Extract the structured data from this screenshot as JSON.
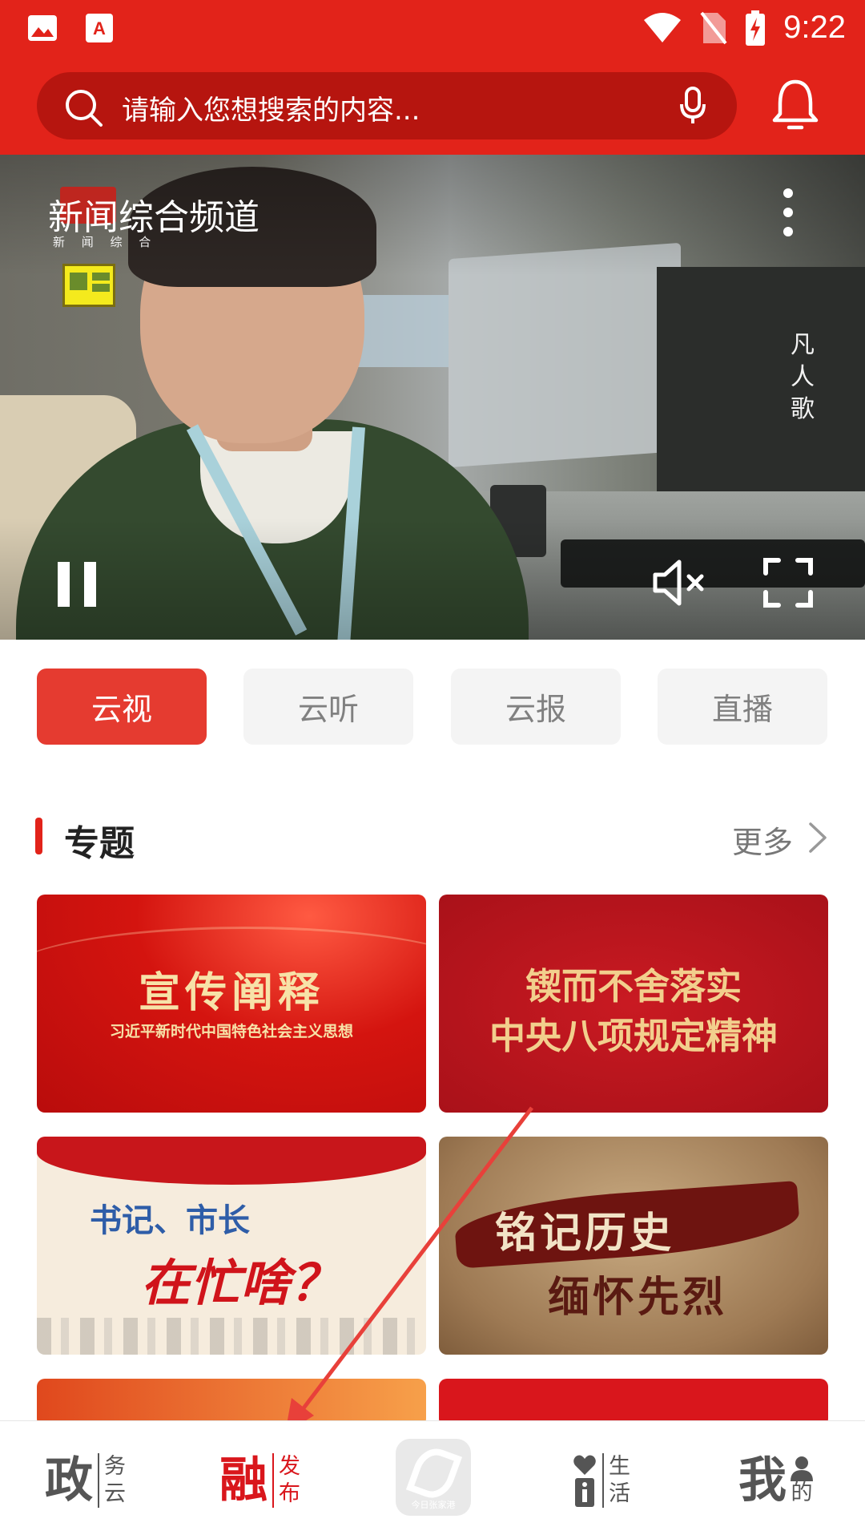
{
  "status_bar": {
    "time": "9:22",
    "icons": [
      "image-icon",
      "app-notification-icon",
      "wifi-icon",
      "no-sim-icon",
      "battery-charging-icon"
    ]
  },
  "header": {
    "search_placeholder": "请输入您想搜索的内容...",
    "icons": [
      "search-icon",
      "microphone-icon",
      "bell-icon"
    ]
  },
  "video": {
    "channel_title": "新闻综合频道",
    "channel_subtitle": "新 闻 综 合",
    "side_caption": "凡人歌",
    "controls": [
      "pause-icon",
      "mute-icon",
      "fullscreen-icon",
      "more-options-icon"
    ]
  },
  "tabs": [
    {
      "label": "云视",
      "active": true
    },
    {
      "label": "云听",
      "active": false
    },
    {
      "label": "云报",
      "active": false
    },
    {
      "label": "直播",
      "active": false
    }
  ],
  "section": {
    "title": "专题",
    "more_label": "更多"
  },
  "cards": [
    {
      "line1": "宣传阐释",
      "line2": "习近平新时代中国特色社会主义思想"
    },
    {
      "line1": "锲而不舍落实",
      "line2": "中央八项规定精神"
    },
    {
      "line1": "书记、市长",
      "line2": "在忙啥？"
    },
    {
      "line1": "铭记历史",
      "line2": "缅怀先烈"
    }
  ],
  "bottom_nav": [
    {
      "big": "政",
      "small": "务云",
      "active": false
    },
    {
      "big": "融",
      "small": "发布",
      "active": true
    },
    {
      "logo_text": "今日张家港"
    },
    {
      "big": "",
      "small": "生活",
      "active": false
    },
    {
      "big": "我",
      "small": "的",
      "active": false
    }
  ],
  "colors": {
    "brand_red": "#e2231a",
    "search_bg": "#b6150f",
    "active_tab": "#e53b30",
    "inactive_tab": "#f4f4f4",
    "annotation_arrow": "#e8403a"
  }
}
